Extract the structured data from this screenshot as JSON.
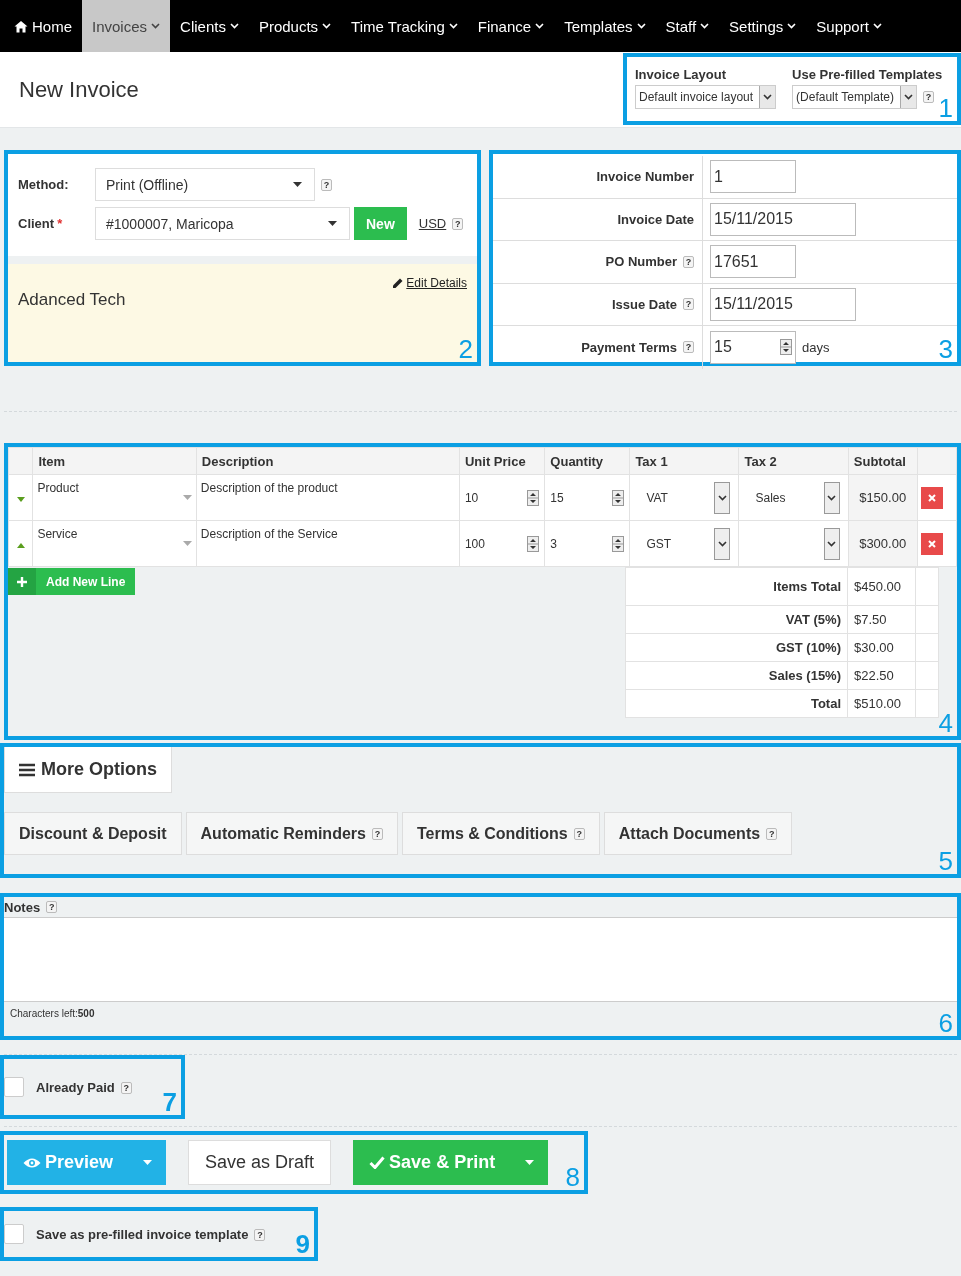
{
  "nav": [
    {
      "label": "Home",
      "kind": "home",
      "selected": false
    },
    {
      "label": "Invoices",
      "kind": "menu",
      "selected": true
    },
    {
      "label": "Clients",
      "kind": "menu",
      "selected": false
    },
    {
      "label": "Products",
      "kind": "menu",
      "selected": false
    },
    {
      "label": "Time Tracking",
      "kind": "menu",
      "selected": false
    },
    {
      "label": "Finance",
      "kind": "menu",
      "selected": false
    },
    {
      "label": "Templates",
      "kind": "menu",
      "selected": false
    },
    {
      "label": "Staff",
      "kind": "menu",
      "selected": false
    },
    {
      "label": "Settings",
      "kind": "menu",
      "selected": false
    },
    {
      "label": "Support",
      "kind": "menu",
      "selected": false
    }
  ],
  "header": {
    "title": "New Invoice",
    "callout": "1",
    "fields": [
      {
        "label": "Invoice Layout",
        "value": "Default invoice layout"
      },
      {
        "label": "Use Pre-filled Templates",
        "value": "(Default Template)",
        "help": "?"
      }
    ]
  },
  "client_panel": {
    "callout": "2",
    "method": {
      "label": "Method:",
      "value": "Print (Offline)",
      "help": "?"
    },
    "client": {
      "label": "Client",
      "required": "*",
      "value": "#1000007, Maricopa",
      "help": "?"
    },
    "new_button": "New",
    "currency": "USD",
    "client_name": "Adanced Tech",
    "edit_link": "Edit Details"
  },
  "invoice_details": {
    "callout": "3",
    "fields": [
      {
        "label": "Invoice Number",
        "value": "1",
        "kind": "text"
      },
      {
        "label": "Invoice Date",
        "value": "15/11/2015",
        "kind": "date"
      },
      {
        "label": "PO Number",
        "value": "17651",
        "kind": "text",
        "help": "?"
      },
      {
        "label": "Issue Date",
        "value": "15/11/2015",
        "kind": "date",
        "help": "?"
      },
      {
        "label": "Payment Terms",
        "value": "15",
        "kind": "spinner",
        "help": "?",
        "unit": "days"
      }
    ]
  },
  "line_items": {
    "callout": "4",
    "columns": [
      "Item",
      "Description",
      "Unit Price",
      "Quantity",
      "Tax 1",
      "Tax 2",
      "Subtotal"
    ],
    "rows": [
      {
        "expanded": true,
        "item": "Product",
        "description": "Description of the product",
        "unit_price": "10",
        "quantity": "15",
        "tax_1": "VAT",
        "tax_2": "Sales",
        "subtotal": "$150.00"
      },
      {
        "expanded": false,
        "item": "Service",
        "description": "Description of the Service",
        "unit_price": "100",
        "quantity": "3",
        "tax_1": "GST",
        "subtotal": "$300.00"
      }
    ],
    "add_button": "Add New Line",
    "totals": [
      {
        "label": "Items Total",
        "value": "$450.00"
      },
      {
        "label": "VAT (5%)",
        "value": "$7.50"
      },
      {
        "label": "GST (10%)",
        "value": "$30.00"
      },
      {
        "label": "Sales (15%)",
        "value": "$22.50"
      },
      {
        "label": "Total",
        "value": "$510.00"
      }
    ]
  },
  "more_options": {
    "callout": "5",
    "title": "More Options",
    "tabs": [
      {
        "label": "Discount & Deposit"
      },
      {
        "label": "Automatic Reminders",
        "help": "?"
      },
      {
        "label": "Terms & Conditions",
        "help": "?"
      },
      {
        "label": "Attach Documents",
        "help": "?"
      }
    ]
  },
  "notes": {
    "callout": "6",
    "label": "Notes",
    "help": "?",
    "counter": "Characters left:**500**"
  },
  "already_paid": {
    "callout": "7",
    "label": "Already Paid",
    "help": "?",
    "checked": false
  },
  "actions": {
    "callout": "8",
    "buttons": [
      {
        "label": "Preview",
        "kind": "preview"
      },
      {
        "label": "Save as Draft",
        "kind": "plain"
      },
      {
        "label": "Save & Print",
        "kind": "save"
      }
    ]
  },
  "save_template": {
    "callout": "9",
    "label": "Save as pre-filled invoice template",
    "help": "?",
    "checked": false
  }
}
